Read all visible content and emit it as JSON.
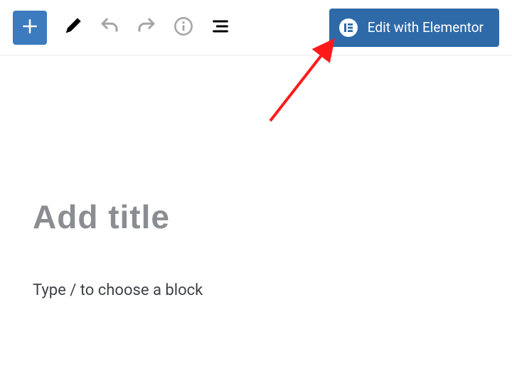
{
  "toolbar": {
    "elementor_label": "Edit with Elementor"
  },
  "editor": {
    "title_placeholder": "Add title",
    "block_placeholder": "Type / to choose a block"
  }
}
